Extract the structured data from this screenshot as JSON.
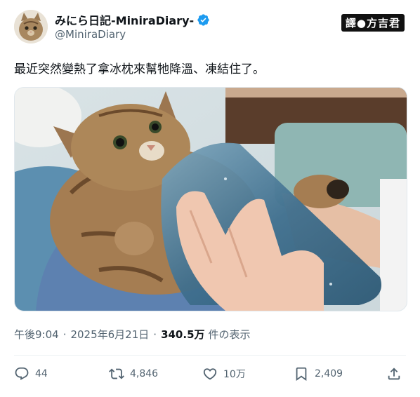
{
  "user": {
    "display_name": "みにら日記-MiniraDiary-",
    "handle": "@MiniraDiary",
    "verified": true
  },
  "watermark": "譯●方吉君",
  "tweet": {
    "text": "最近突然變熱了拿冰枕來幫牠降溫、凍結住了。",
    "image_alt": "tabby cat lying on a lap while a hand presses a blue ice pack onto its belly"
  },
  "meta": {
    "time": "午後9:04",
    "separator": "·",
    "date": "2025年6月21日",
    "views": "340.5万",
    "views_label": "件の表示"
  },
  "actions": {
    "replies": "44",
    "retweets": "4,846",
    "likes": "10万",
    "bookmarks": "2,409"
  },
  "icons": [
    "verified-badge-icon",
    "reply-icon",
    "retweet-icon",
    "like-icon",
    "bookmark-icon",
    "share-icon"
  ],
  "colors": {
    "verified": "#1d9bf0",
    "secondary_text": "#536471",
    "primary_text": "#0f1419"
  }
}
